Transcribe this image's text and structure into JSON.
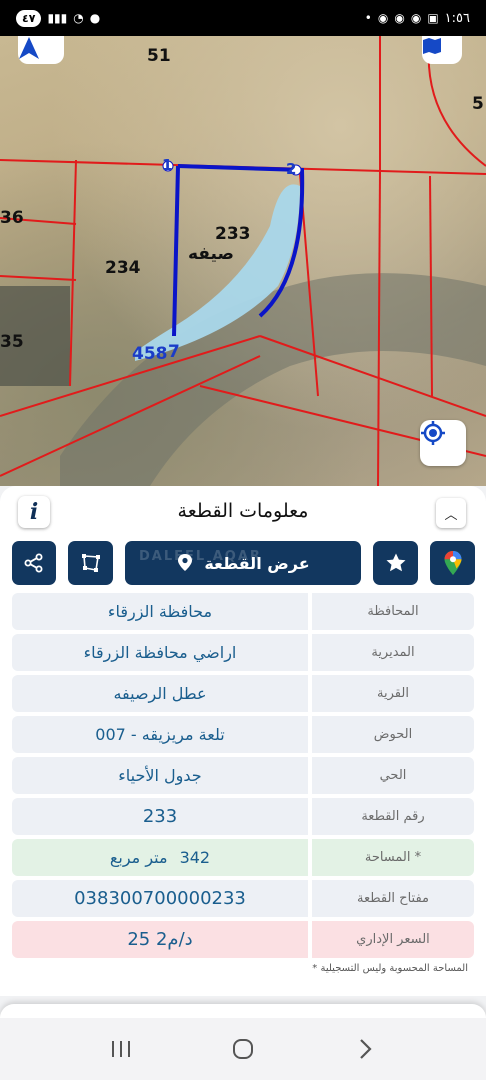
{
  "status_bar": {
    "time": "١:٥٦",
    "battery": "٤٧"
  },
  "map": {
    "parcel_labels": {
      "p51": "51",
      "p5": "5",
      "p36": "36",
      "p234": "234",
      "p233": "233",
      "p35": "35",
      "area_name": "صيفه",
      "street": "458",
      "street_suffix": "7"
    },
    "vertices": {
      "v1": "1",
      "v2": "2"
    },
    "colors": {
      "boundary": "#e11b1b",
      "parcel_outline": "#0a14c8",
      "highlight": "#a9d7ea"
    }
  },
  "panel": {
    "title": "معلومات القطعة",
    "info_icon": "i",
    "show_parcel_label": "عرض القطعة",
    "watermark": "DALEEL AQAR",
    "rows": [
      {
        "label": "المحافظة",
        "value": "محافظة الزرقاء"
      },
      {
        "label": "المديرية",
        "value": "اراضي محافظة الزرقاء"
      },
      {
        "label": "القرية",
        "value": "عطل الرصيفه"
      },
      {
        "label": "الحوض",
        "value": "تلعة مريزيقه - 007"
      },
      {
        "label": "الحي",
        "value": "جدول الأحياء"
      },
      {
        "label": "رقم القطعة",
        "value": "233"
      },
      {
        "label": "المساحة *",
        "value_number": "342",
        "value_unit": "متر مربع"
      },
      {
        "label": "مفتاح القطعة",
        "value": "038300700000233"
      },
      {
        "label": "السعر الإداري",
        "value": "25 د/م2"
      }
    ],
    "footnote": "* المساحة المحسوبة وليس التسجيلية"
  }
}
